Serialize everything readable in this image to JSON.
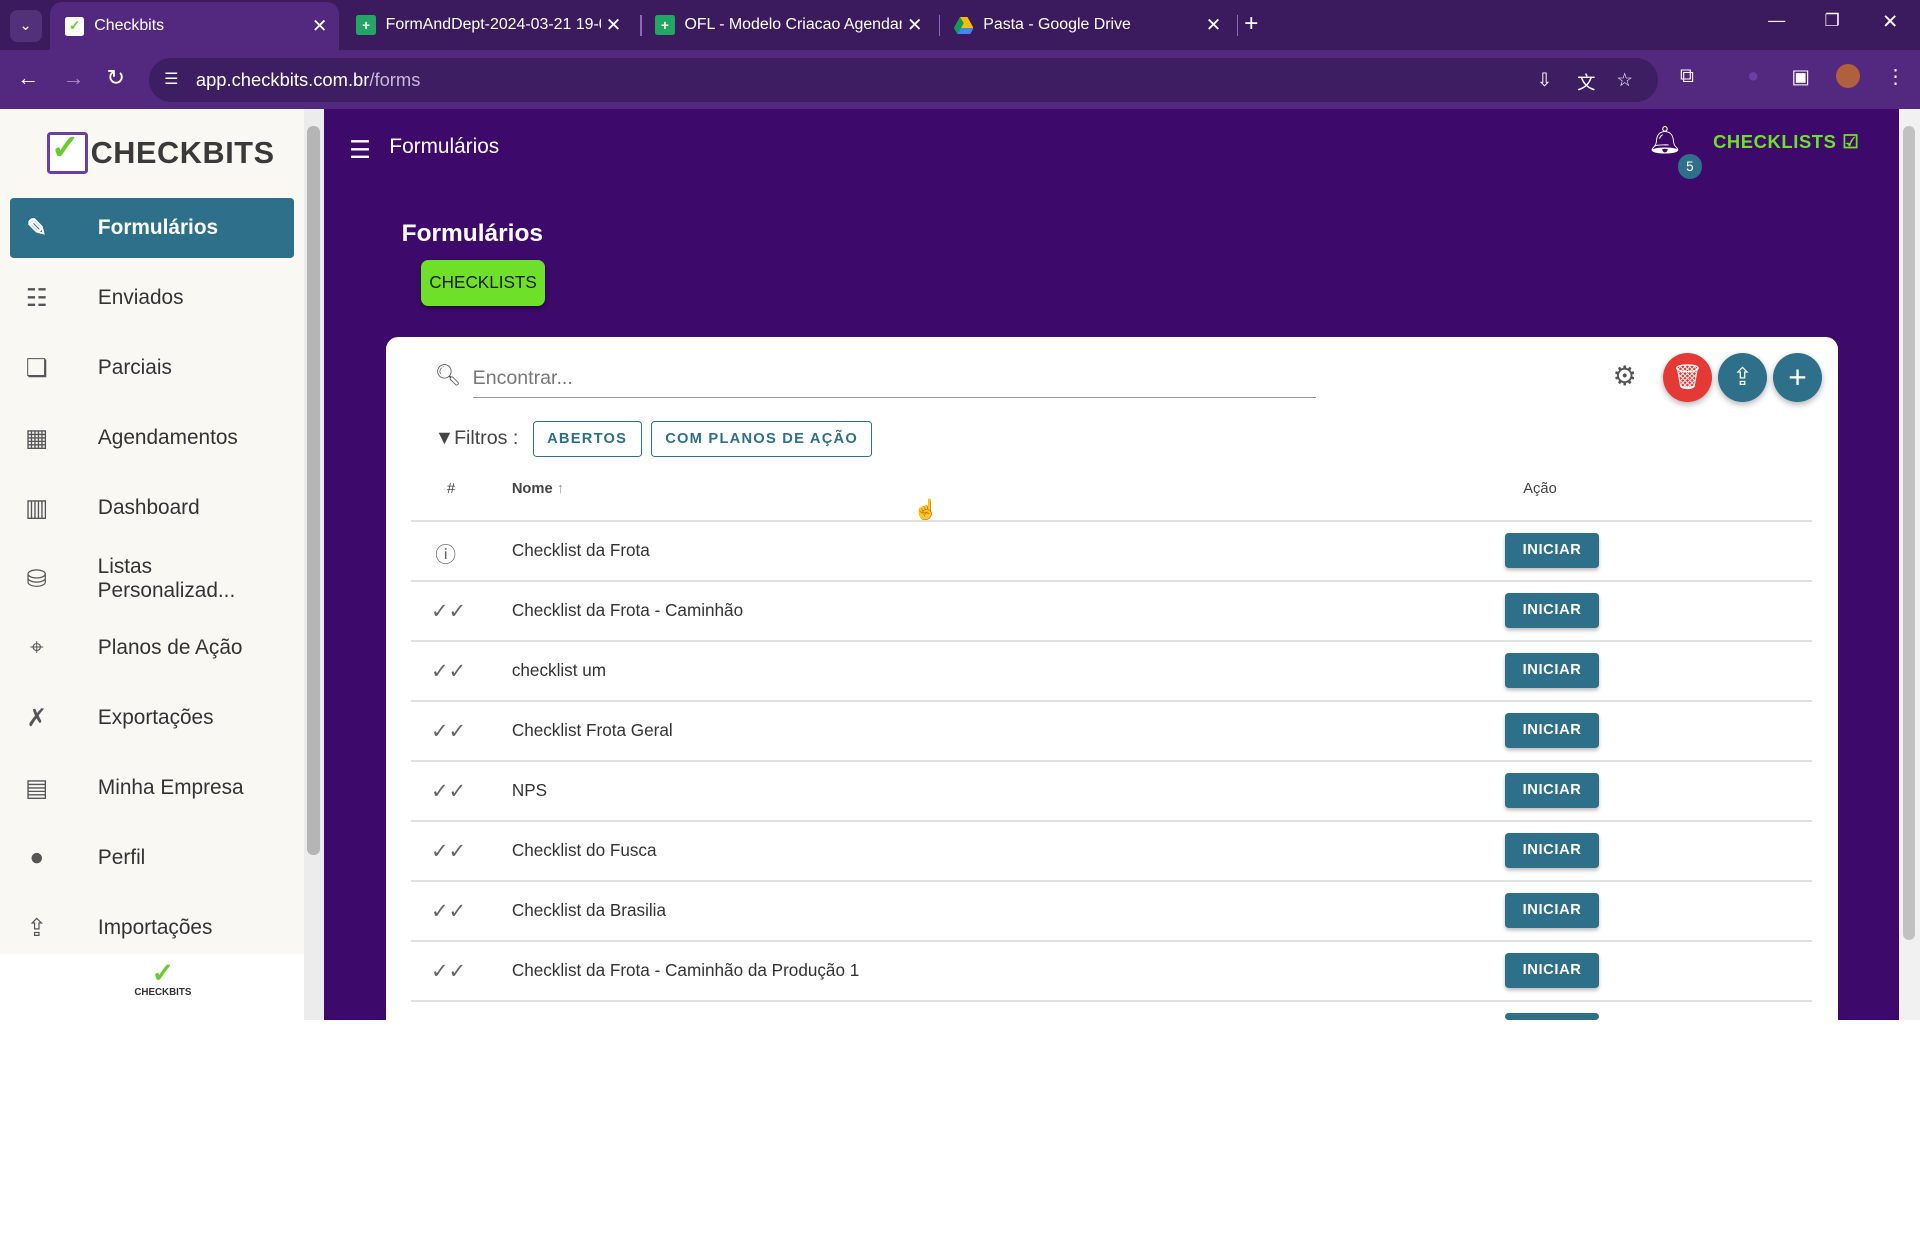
{
  "browser": {
    "tabs": [
      {
        "title": "Checkbits",
        "favicon": "checkbits-favicon"
      },
      {
        "title": "FormAndDept-2024-03-21 19-0",
        "favicon": "sheets-favicon"
      },
      {
        "title": "OFL - Modelo Criacao Agendam",
        "favicon": "sheets-favicon"
      },
      {
        "title": "Pasta - Google Drive",
        "favicon": "drive-favicon"
      }
    ],
    "url_domain": "app.checkbits.com.br",
    "url_path": "/forms"
  },
  "brand": {
    "logo_text": "CHECKBITS",
    "footer_logo_text": "CHECKBITS"
  },
  "sidebar": {
    "items": [
      {
        "label": "Formulários",
        "icon": "form-edit-icon"
      },
      {
        "label": "Enviados",
        "icon": "list-check-icon"
      },
      {
        "label": "Parciais",
        "icon": "file-copy-icon"
      },
      {
        "label": "Agendamentos",
        "icon": "calendar-check-icon"
      },
      {
        "label": "Dashboard",
        "icon": "bar-chart-icon"
      },
      {
        "label": "Listas Personalizad...",
        "icon": "database-icon"
      },
      {
        "label": "Planos de Ação",
        "icon": "crosshair-icon"
      },
      {
        "label": "Exportações",
        "icon": "excel-file-icon"
      },
      {
        "label": "Minha Empresa",
        "icon": "building-icon"
      },
      {
        "label": "Perfil",
        "icon": "person-icon"
      },
      {
        "label": "Importações",
        "icon": "file-import-icon"
      }
    ]
  },
  "header": {
    "title": "Formulários",
    "notification_count": "5",
    "right_label": "CHECKLISTS"
  },
  "page": {
    "title": "Formulários",
    "category_chip": "CHECKLISTS"
  },
  "search": {
    "placeholder": "Encontrar..."
  },
  "filters": {
    "label": "Filtros :",
    "buttons": [
      "ABERTOS",
      "COM PLANOS DE AÇÃO"
    ]
  },
  "table": {
    "columns": {
      "index": "#",
      "name": "Nome",
      "action": "Ação"
    },
    "rows": [
      {
        "name": "Checklist da Frota",
        "status_icon": "info-icon",
        "action": "INICIAR"
      },
      {
        "name": "Checklist da Frota - Caminhão",
        "status_icon": "double-check-icon",
        "action": "INICIAR"
      },
      {
        "name": "checklist um",
        "status_icon": "double-check-icon",
        "action": "INICIAR"
      },
      {
        "name": "Checklist Frota Geral",
        "status_icon": "double-check-icon",
        "action": "INICIAR"
      },
      {
        "name": "NPS",
        "status_icon": "double-check-icon",
        "action": "INICIAR"
      },
      {
        "name": "Checklist do Fusca",
        "status_icon": "double-check-icon",
        "action": "INICIAR"
      },
      {
        "name": "Checklist da Brasilia",
        "status_icon": "double-check-icon",
        "action": "INICIAR"
      },
      {
        "name": "Checklist da Frota - Caminhão da Produção 1",
        "status_icon": "double-check-icon",
        "action": "INICIAR"
      }
    ]
  },
  "colors": {
    "primary": "#2e6f8a",
    "accent": "#6ee02a",
    "main_bg": "#3d0a6b",
    "delete": "#e53935"
  }
}
